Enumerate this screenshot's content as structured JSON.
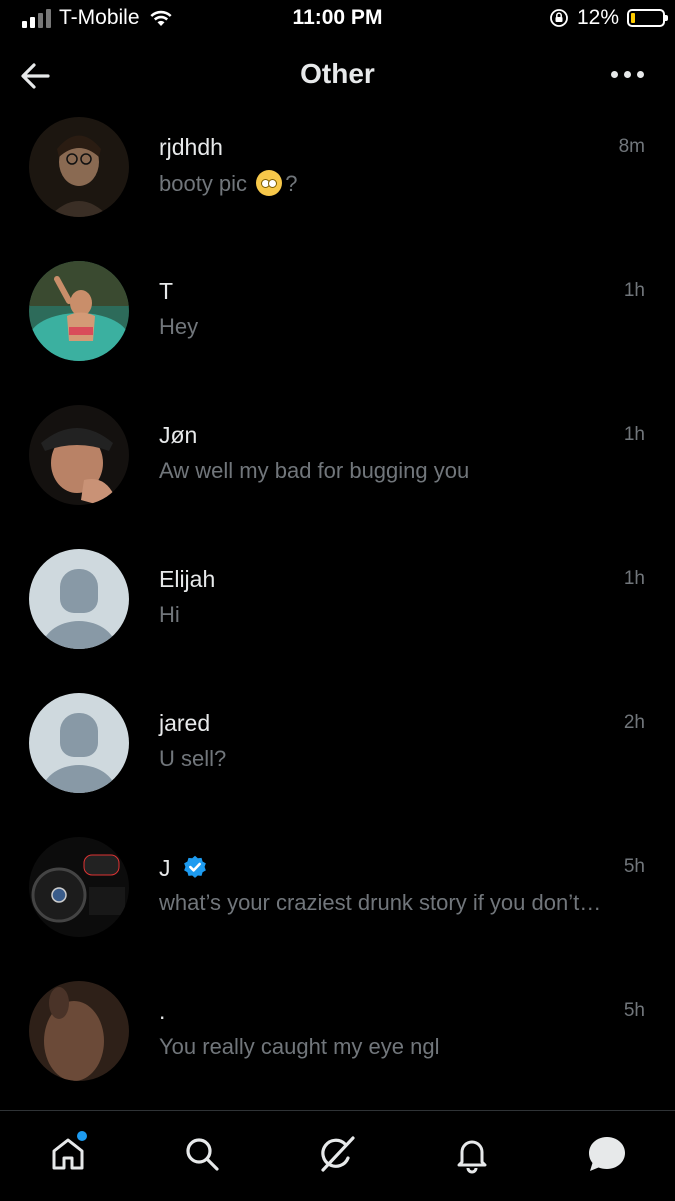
{
  "status_bar": {
    "carrier": "T-Mobile",
    "time": "11:00 PM",
    "battery_percent": "12%",
    "battery_level": 0.12,
    "icons": [
      "signal-icon",
      "wifi-icon",
      "orientation-lock-icon",
      "battery-icon"
    ]
  },
  "header": {
    "title": "Other",
    "back_icon": "back-arrow-icon",
    "more_icon": "more-options-icon"
  },
  "conversations": [
    {
      "name": "rjdhdh",
      "time": "8m",
      "preview_before": "booty pic",
      "preview_emoji": "eye-roll-emoji",
      "preview_after": "?",
      "avatar": "photo",
      "verified": false
    },
    {
      "name": "T",
      "time": "1h",
      "preview": "Hey",
      "avatar": "photo",
      "verified": false
    },
    {
      "name": "Jøn",
      "time": "1h",
      "preview": "Aw well my bad for bugging you",
      "avatar": "photo",
      "verified": false
    },
    {
      "name": "Elijah",
      "time": "1h",
      "preview": "Hi",
      "avatar": "default",
      "verified": false
    },
    {
      "name": "jared",
      "time": "2h",
      "preview": "U sell?",
      "avatar": "default",
      "verified": false
    },
    {
      "name": "J",
      "time": "5h",
      "preview": "what’s your craziest drunk story if you don’t…",
      "avatar": "photo",
      "verified": true
    },
    {
      "name": ".",
      "time": "5h",
      "preview": "You really caught my eye ngl",
      "avatar": "photo",
      "verified": false
    }
  ],
  "tab_bar": {
    "items": [
      "home-icon",
      "search-icon",
      "grok-icon",
      "notifications-icon",
      "messages-icon"
    ],
    "active": "messages-icon",
    "accent_color": "#1d9bf0"
  }
}
